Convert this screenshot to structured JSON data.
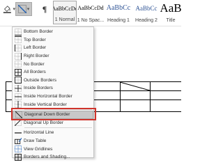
{
  "ribbon": {
    "shading_icon": "shading-bucket-icon",
    "borders_icon": "borders-icon",
    "pilcrow": "¶",
    "styles": [
      {
        "preview": "AaBbCcDd",
        "name": "1 Normal",
        "selected": true
      },
      {
        "preview": "AaBbCcDd",
        "name": "1 No Spac...",
        "selected": false
      },
      {
        "preview": "AaBbCc",
        "name": "Heading 1",
        "selected": false
      },
      {
        "preview": "AaBbCc",
        "name": "Heading 2",
        "selected": false
      },
      {
        "preview": "AaB",
        "name": "Title",
        "selected": false
      }
    ]
  },
  "menu": {
    "items": [
      {
        "label": "Bottom Border",
        "icon": "bottom-border-icon"
      },
      {
        "label": "Top Border",
        "icon": "top-border-icon"
      },
      {
        "label": "Left Border",
        "icon": "left-border-icon"
      },
      {
        "label": "Right Border",
        "icon": "right-border-icon"
      },
      {
        "label": "No Border",
        "icon": "no-border-icon"
      },
      {
        "label": "All Borders",
        "icon": "all-borders-icon"
      },
      {
        "label": "Outside Borders",
        "icon": "outside-borders-icon"
      },
      {
        "label": "Inside Borders",
        "icon": "inside-borders-icon"
      },
      {
        "label": "Inside Horizontal Border",
        "icon": "inside-horizontal-border-icon"
      },
      {
        "label": "Inside Vertical Border",
        "icon": "inside-vertical-border-icon"
      },
      {
        "label": "Diagonal Down Border",
        "icon": "diagonal-down-border-icon",
        "hovered": true
      },
      {
        "label": "Diagonal Up Border",
        "icon": "diagonal-up-border-icon"
      },
      {
        "label": "Horizontal Line",
        "icon": "horizontal-line-icon"
      },
      {
        "label": "Draw Table",
        "icon": "draw-table-icon"
      },
      {
        "label": "View Gridlines",
        "icon": "view-gridlines-icon"
      },
      {
        "label": "Borders and Shading...",
        "icon": "borders-and-shading-icon"
      }
    ],
    "highlight_color": "#d0342c",
    "hover_color": "#c8c8c8"
  }
}
